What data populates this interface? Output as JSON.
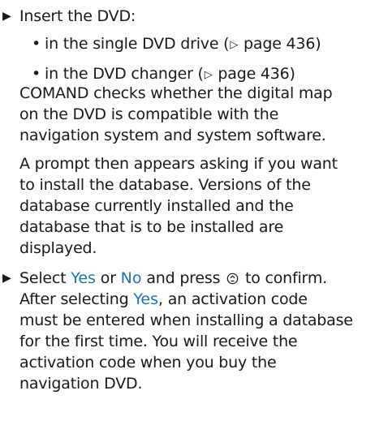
{
  "colors": {
    "text": "#1a1a1a",
    "highlight": "#1f74b6"
  },
  "steps": [
    {
      "marker": "▶",
      "intro": "Insert the DVD:",
      "bullets": [
        {
          "bullet": "•",
          "text": "in the single DVD drive (",
          "ref_icon": "▷",
          "ref": " page 436)"
        },
        {
          "bullet": "•",
          "text": "in the DVD changer (",
          "ref_icon": "▷",
          "ref": " page 436)"
        }
      ],
      "para1_lines": [
        "COMAND checks whether the digital map",
        "on the DVD is compatible with the",
        "navigation system and system software."
      ],
      "para2_lines": [
        "A prompt then appears asking if you want",
        "to install the database. Versions of the",
        "database currently installed and the",
        "database that is to be installed are",
        "displayed."
      ]
    },
    {
      "marker": "▶",
      "line1_prefix": "Select ",
      "yes": "Yes",
      "line1_or": " or ",
      "no": "No",
      "line1_suffix_a": " and press ",
      "confirm_icon": "controller-knob-icon",
      "line1_suffix_b": " to confirm.",
      "line2_prefix": "After selecting ",
      "line2_yes": "Yes",
      "line2_suffix": ", an activation code",
      "rest_lines": [
        "must be entered when installing a database",
        "for the first time. You will receive the",
        "activation code when you buy the",
        "navigation DVD."
      ]
    }
  ]
}
